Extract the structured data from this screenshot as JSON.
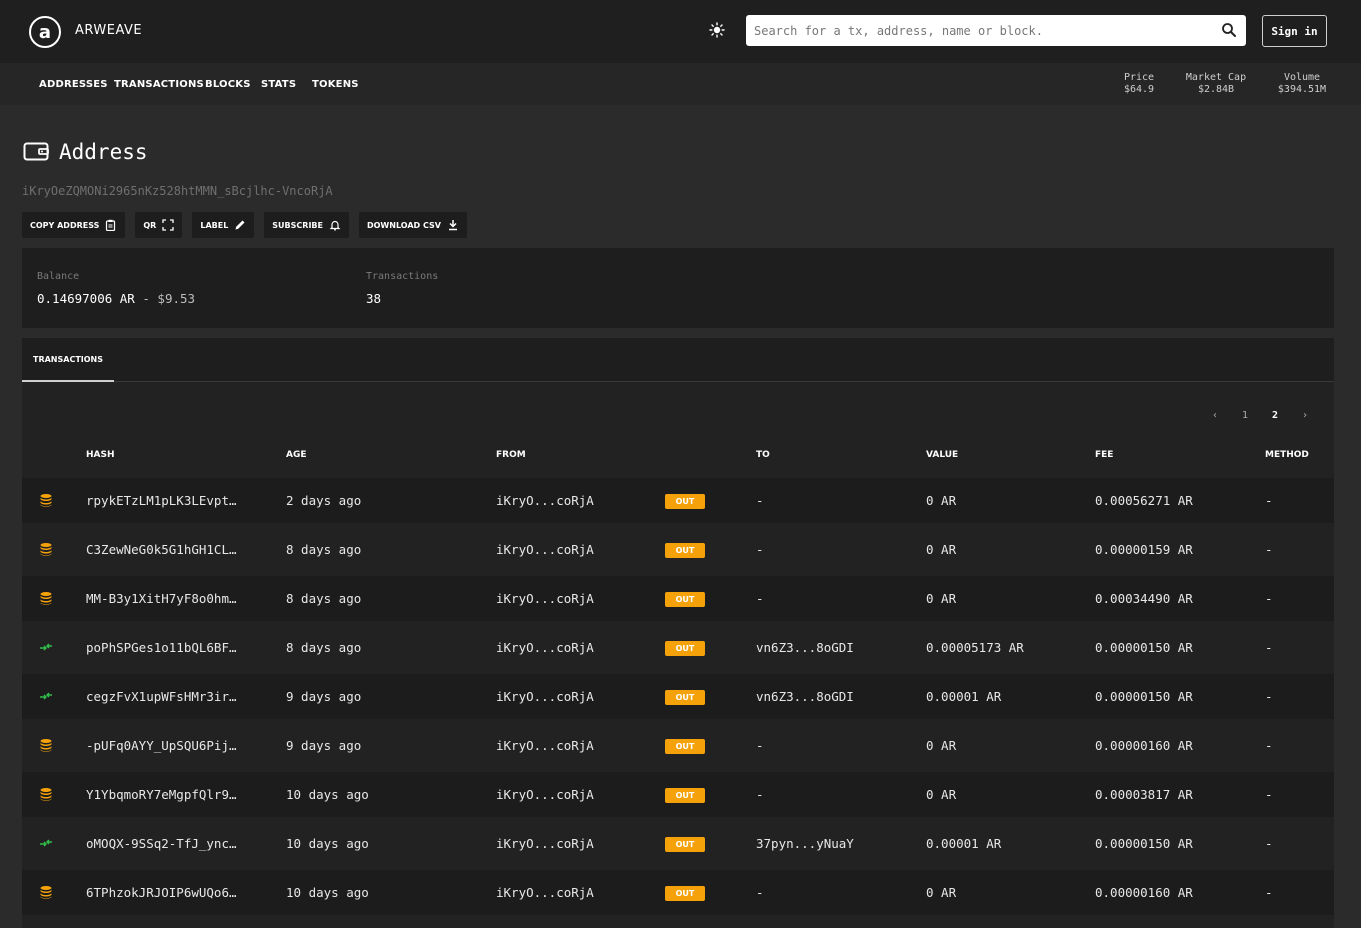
{
  "header": {
    "brand": "ARWEAVE",
    "logo_letter": "a",
    "search_placeholder": "Search for a tx, address, name or block.",
    "signin_label": "Sign in"
  },
  "nav": {
    "items": [
      "ADDRESSES",
      "TRANSACTIONS",
      "BLOCKS",
      "STATS",
      "TOKENS"
    ],
    "stats": [
      {
        "label": "Price",
        "value": "$64.9"
      },
      {
        "label": "Market Cap",
        "value": "$2.84B"
      },
      {
        "label": "Volume",
        "value": "$394.51M"
      }
    ]
  },
  "page": {
    "title": "Address",
    "address": "iKryOeZQMONi2965nKz528htMMN_sBcjlhc-VncoRjA",
    "actions": [
      "COPY ADDRESS",
      "QR",
      "LABEL",
      "SUBSCRIBE",
      "DOWNLOAD CSV"
    ]
  },
  "summary": {
    "balance_label": "Balance",
    "balance_value": "0.14697006 AR",
    "balance_sep": " - ",
    "balance_usd": "$9.53",
    "tx_label": "Transactions",
    "tx_value": "38"
  },
  "tabs": {
    "active": "TRANSACTIONS"
  },
  "pager": {
    "prev": "‹",
    "pages": [
      "1",
      "2"
    ],
    "current": "2",
    "next": "›"
  },
  "table": {
    "columns": [
      "HASH",
      "AGE",
      "FROM",
      "TO",
      "VALUE",
      "FEE",
      "METHOD"
    ],
    "direction_label": "OUT",
    "rows": [
      {
        "icon": "coins-icon",
        "hash": "rpykETzLM1pLK3LEvpt…",
        "age": "2 days ago",
        "from": "iKryO...coRjA",
        "to": "-",
        "value": "0 AR",
        "fee": "0.00056271 AR",
        "method": "-"
      },
      {
        "icon": "coins-icon",
        "hash": "C3ZewNeG0k5G1hGH1CL…",
        "age": "8 days ago",
        "from": "iKryO...coRjA",
        "to": "-",
        "value": "0 AR",
        "fee": "0.00000159 AR",
        "method": "-"
      },
      {
        "icon": "coins-icon",
        "hash": "MM-B3y1XitH7yF8o0hm…",
        "age": "8 days ago",
        "from": "iKryO...coRjA",
        "to": "-",
        "value": "0 AR",
        "fee": "0.00034490 AR",
        "method": "-"
      },
      {
        "icon": "transfer-icon",
        "hash": "poPhSPGes1o11bQL6BF…",
        "age": "8 days ago",
        "from": "iKryO...coRjA",
        "to": "vn6Z3...8oGDI",
        "value": "0.00005173 AR",
        "fee": "0.00000150 AR",
        "method": "-"
      },
      {
        "icon": "transfer-icon",
        "hash": "cegzFvX1upWFsHMr3ir…",
        "age": "9 days ago",
        "from": "iKryO...coRjA",
        "to": "vn6Z3...8oGDI",
        "value": "0.00001 AR",
        "fee": "0.00000150 AR",
        "method": "-"
      },
      {
        "icon": "coins-icon",
        "hash": "-pUFq0AYY_UpSQU6Pij…",
        "age": "9 days ago",
        "from": "iKryO...coRjA",
        "to": "-",
        "value": "0 AR",
        "fee": "0.00000160 AR",
        "method": "-"
      },
      {
        "icon": "coins-icon",
        "hash": "Y1YbqmoRY7eMgpfQlr9…",
        "age": "10 days ago",
        "from": "iKryO...coRjA",
        "to": "-",
        "value": "0 AR",
        "fee": "0.00003817 AR",
        "method": "-"
      },
      {
        "icon": "transfer-icon",
        "hash": "oMOQX-9SSq2-TfJ_ync…",
        "age": "10 days ago",
        "from": "iKryO...coRjA",
        "to": "37pyn...yNuaY",
        "value": "0.00001 AR",
        "fee": "0.00000150 AR",
        "method": "-"
      },
      {
        "icon": "coins-icon",
        "hash": "6TPhzokJRJOIP6wUQo6…",
        "age": "10 days ago",
        "from": "iKryO...coRjA",
        "to": "-",
        "value": "0 AR",
        "fee": "0.00000160 AR",
        "method": "-"
      }
    ]
  },
  "colors": {
    "accent": "#f5a20a",
    "transfer_icon": "#2fbf4a",
    "coins_icon": "#f5a20a"
  }
}
